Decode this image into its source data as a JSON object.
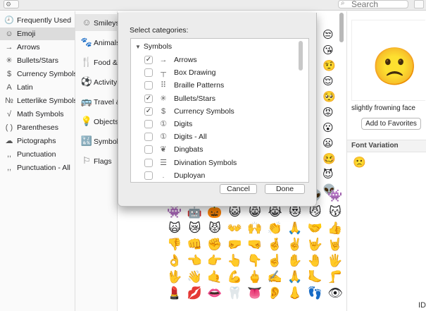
{
  "toolbar": {
    "gear_glyph": "⚙ ⌄",
    "search_placeholder": "Search"
  },
  "sidebar": {
    "items": [
      {
        "icon": "clock-icon",
        "glyph": "🕘",
        "label": "Frequently Used"
      },
      {
        "icon": "emoji-face-icon",
        "glyph": "☺",
        "label": "Emoji",
        "selected": true
      },
      {
        "icon": "arrow-icon",
        "glyph": "→",
        "label": "Arrows"
      },
      {
        "icon": "star-burst-icon",
        "glyph": "✳",
        "label": "Bullets/Stars"
      },
      {
        "icon": "dollar-icon",
        "glyph": "$",
        "label": "Currency Symbols"
      },
      {
        "icon": "latin-a-icon",
        "glyph": "A",
        "label": "Latin"
      },
      {
        "icon": "numero-icon",
        "glyph": "№",
        "label": "Letterlike Symbols"
      },
      {
        "icon": "sqrt-icon",
        "glyph": "√",
        "label": "Math Symbols"
      },
      {
        "icon": "parentheses-icon",
        "glyph": "( )",
        "label": "Parentheses"
      },
      {
        "icon": "pictograph-icon",
        "glyph": "☁",
        "label": "Pictographs"
      },
      {
        "icon": "comma-icon",
        "glyph": ",,",
        "label": "Punctuation"
      },
      {
        "icon": "comma-icon",
        "glyph": ",,",
        "label": "Punctuation - All"
      }
    ]
  },
  "categories": {
    "items": [
      {
        "icon": "smiley-icon",
        "glyph": "☺",
        "label": "Smileys",
        "selected": true
      },
      {
        "icon": "animal-icon",
        "glyph": "🐾",
        "label": "Animals"
      },
      {
        "icon": "food-icon",
        "glyph": "🍴",
        "label": "Food &"
      },
      {
        "icon": "activity-icon",
        "glyph": "⚽",
        "label": "Activity"
      },
      {
        "icon": "travel-icon",
        "glyph": "🚌",
        "label": "Travel &"
      },
      {
        "icon": "objects-icon",
        "glyph": "💡",
        "label": "Objects"
      },
      {
        "icon": "symbols-icon",
        "glyph": "🔣",
        "label": "Symbols"
      },
      {
        "icon": "flag-icon",
        "glyph": "⚐",
        "label": "Flags"
      }
    ]
  },
  "dialog": {
    "prompt": "Select categories:",
    "group_label": "Symbols",
    "rows": [
      {
        "checked": true,
        "glyph": "→",
        "label": "Arrows"
      },
      {
        "checked": false,
        "glyph": "┬",
        "label": "Box Drawing"
      },
      {
        "checked": false,
        "glyph": "⠿",
        "label": "Braille Patterns"
      },
      {
        "checked": true,
        "glyph": "✳",
        "label": "Bullets/Stars"
      },
      {
        "checked": true,
        "glyph": "$",
        "label": "Currency Symbols"
      },
      {
        "checked": false,
        "glyph": "①",
        "label": "Digits"
      },
      {
        "checked": false,
        "glyph": "①",
        "label": "Digits - All"
      },
      {
        "checked": false,
        "glyph": "❦",
        "label": "Dingbats"
      },
      {
        "checked": false,
        "glyph": "☰",
        "label": "Divination Symbols"
      },
      {
        "checked": false,
        "glyph": "𛰀",
        "label": "Duployan"
      }
    ],
    "cancel_label": "Cancel",
    "done_label": "Done"
  },
  "emoji_strip": [
    "😒",
    "😘",
    "🤨",
    "😌",
    "🥺",
    "😡",
    "😮",
    "😦",
    "🥴",
    "😈",
    "👽"
  ],
  "emoji_grid": [
    [
      "💩",
      "🤡",
      "👹",
      "👺",
      "👻",
      "💀",
      "☠️",
      "👽",
      "👾"
    ],
    [
      "👾",
      "🤖",
      "🎃",
      "😺",
      "😸",
      "😹",
      "😻",
      "😼",
      "😽"
    ],
    [
      "🙀",
      "😿",
      "😾",
      "👐",
      "🙌",
      "👏",
      "🙏",
      "🤝",
      "👍"
    ],
    [
      "👎",
      "👊",
      "✊",
      "🤛",
      "🤜",
      "🤞",
      "✌️",
      "🤟",
      "🤘"
    ],
    [
      "👌",
      "👈",
      "👉",
      "👆",
      "👇",
      "☝️",
      "✋",
      "🤚",
      "🖐"
    ],
    [
      "🖖",
      "👋",
      "🤙",
      "💪",
      "🖕",
      "✍️",
      "🙏",
      "🦶",
      "🦵"
    ],
    [
      "💄",
      "💋",
      "👄",
      "🦷",
      "👅",
      "👂",
      "👃",
      "👣",
      "👁"
    ]
  ],
  "info": {
    "emoji": "🙁",
    "name": "slightly frowning face",
    "favorites_label": "Add to Favorites",
    "font_variation_label": "Font Variation",
    "variation_emoji": "🙁",
    "id_label": "ID"
  }
}
